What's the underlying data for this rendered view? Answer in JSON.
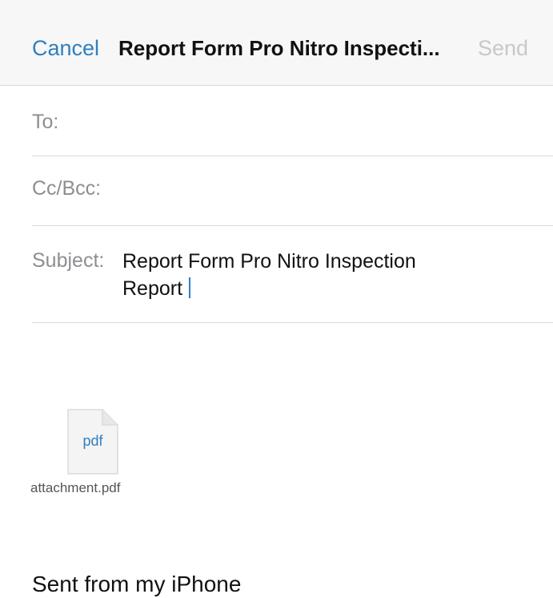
{
  "nav": {
    "cancel_label": "Cancel",
    "title": "Report Form Pro Nitro Inspecti...",
    "send_label": "Send"
  },
  "fields": {
    "to_label": "To:",
    "cc_label": "Cc/Bcc:",
    "subject_label": "Subject:",
    "subject_line1": "Report Form Pro Nitro Inspection",
    "subject_line2": "Report"
  },
  "attachment": {
    "extension": "pdf",
    "filename": "attachment.pdf",
    "icon": "document-icon"
  },
  "body": {
    "signature": "Sent from my iPhone"
  },
  "colors": {
    "accent": "#2f7fc1",
    "disabled": "#c8c8c8",
    "label_gray": "#8e8e93",
    "separator": "#d9d9d9"
  }
}
